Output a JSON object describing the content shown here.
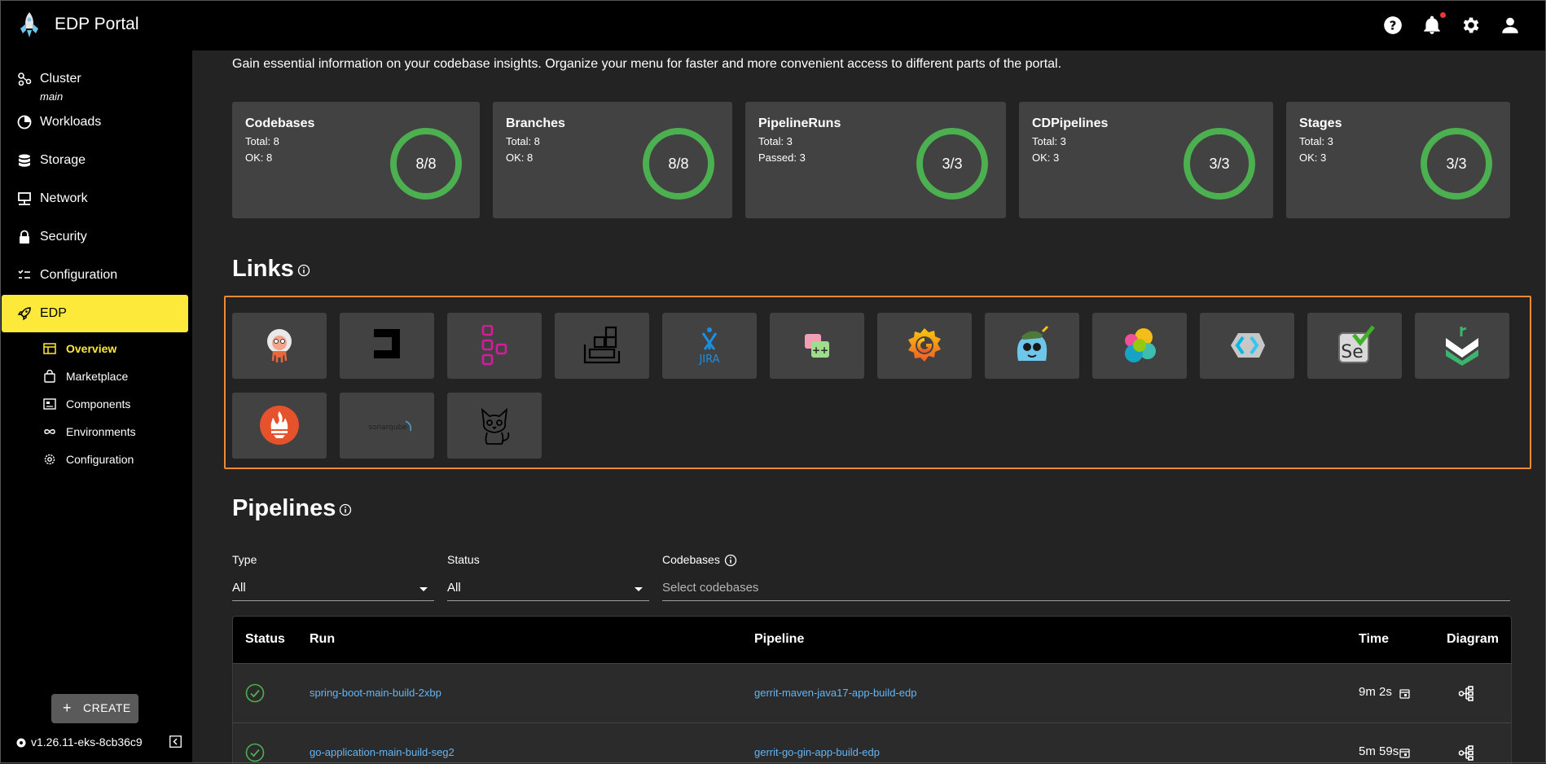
{
  "app": {
    "title": "EDP Portal"
  },
  "sidebar": {
    "items": [
      {
        "label": "Cluster",
        "sublabel": "main",
        "icon": "cluster-icon"
      },
      {
        "label": "Workloads",
        "icon": "workloads-icon"
      },
      {
        "label": "Storage",
        "icon": "storage-icon"
      },
      {
        "label": "Network",
        "icon": "network-icon"
      },
      {
        "label": "Security",
        "icon": "lock-icon"
      },
      {
        "label": "Configuration",
        "icon": "configuration-icon"
      },
      {
        "label": "EDP",
        "icon": "rocket-icon",
        "active": true
      }
    ],
    "subitems": [
      {
        "label": "Overview",
        "icon": "dashboard-icon",
        "active": true
      },
      {
        "label": "Marketplace",
        "icon": "bag-icon"
      },
      {
        "label": "Components",
        "icon": "components-icon"
      },
      {
        "label": "Environments",
        "icon": "infinity-icon"
      },
      {
        "label": "Configuration",
        "icon": "gear-icon"
      }
    ],
    "create_label": "CREATE",
    "version": "v1.26.11-eks-8cb36c9"
  },
  "main": {
    "intro": "Gain essential information on your codebase insights. Organize your menu for faster and more convenient access to different parts of the portal.",
    "cards": [
      {
        "title": "Codebases",
        "line1": "Total: 8",
        "line2": "OK: 8",
        "ring": "8/8",
        "ok": 8,
        "total": 8
      },
      {
        "title": "Branches",
        "line1": "Total: 8",
        "line2": "OK: 8",
        "ring": "8/8",
        "ok": 8,
        "total": 8
      },
      {
        "title": "PipelineRuns",
        "line1": "Total: 3",
        "line2": "Passed: 3",
        "ring": "3/3",
        "ok": 3,
        "total": 3
      },
      {
        "title": "CDPipelines",
        "line1": "Total: 3",
        "line2": "OK: 3",
        "ring": "3/3",
        "ok": 3,
        "total": 3
      },
      {
        "title": "Stages",
        "line1": "Total: 3",
        "line2": "OK: 3",
        "ring": "3/3",
        "ok": 3,
        "total": 3
      }
    ],
    "links_title": "Links",
    "links": [
      {
        "icon": "argocd-icon"
      },
      {
        "icon": "codemie-icon"
      },
      {
        "icon": "pipeline-icon"
      },
      {
        "icon": "docker-registry-icon"
      },
      {
        "icon": "jira-icon"
      },
      {
        "icon": "clusters-icon"
      },
      {
        "icon": "grafana-icon"
      },
      {
        "icon": "kiali-icon"
      },
      {
        "icon": "kibana-icon"
      },
      {
        "icon": "keycloak-icon"
      },
      {
        "icon": "selenium-icon",
        "text": "Se"
      },
      {
        "icon": "rancher-icon"
      },
      {
        "icon": "prometheus-icon"
      },
      {
        "icon": "sonarqube-icon",
        "text": "sonarqube"
      },
      {
        "icon": "cat-icon"
      }
    ],
    "pipelines_title": "Pipelines",
    "filters": {
      "type_label": "Type",
      "type_value": "All",
      "status_label": "Status",
      "status_value": "All",
      "codebases_label": "Codebases",
      "codebases_placeholder": "Select codebases"
    },
    "table": {
      "headers": {
        "status": "Status",
        "run": "Run",
        "pipeline": "Pipeline",
        "time": "Time",
        "diagram": "Diagram"
      },
      "rows": [
        {
          "status": "success",
          "run": "spring-boot-main-build-2xbp",
          "pipeline": "gerrit-maven-java17-app-build-edp",
          "time": "9m 2s"
        },
        {
          "status": "success",
          "run": "go-application-main-build-seg2",
          "pipeline": "gerrit-go-gin-app-build-edp",
          "time": "5m 59s"
        }
      ]
    }
  },
  "colors": {
    "accent": "#fde93a",
    "ring_ok": "#4caf50",
    "link": "#64b5f6",
    "highlight_border": "#f08a32",
    "notification_dot": "#e53935"
  }
}
